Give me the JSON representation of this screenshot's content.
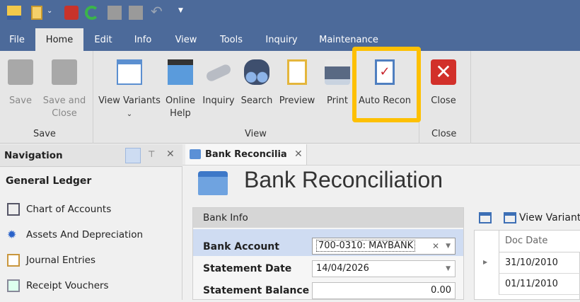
{
  "quick_access": [
    "app-icon",
    "clipboard-icon",
    "key-icon",
    "refresh-icon",
    "save-icon",
    "save-close-icon",
    "undo-icon",
    "customize-icon"
  ],
  "menu_tabs": [
    "File",
    "Home",
    "Edit",
    "Info",
    "View",
    "Tools",
    "Inquiry",
    "Maintenance"
  ],
  "active_tab": "Home",
  "ribbon": {
    "save_group": {
      "label": "Save",
      "buttons": [
        "Save",
        "Save and Close"
      ]
    },
    "view_group": {
      "label": "View",
      "buttons": {
        "view_variants": "View Variants",
        "online_help_1": "Online",
        "online_help_2": "Help",
        "inquiry": "Inquiry",
        "search": "Search",
        "preview": "Preview",
        "print": "Print",
        "auto_recon": "Auto Recon"
      }
    },
    "close_group": {
      "label": "Close",
      "button": "Close"
    },
    "highlight_color": "#fdc003"
  },
  "navigation": {
    "title": "Navigation",
    "section": "General Ledger",
    "items": [
      "Chart of Accounts",
      "Assets And Depreciation",
      "Journal Entries",
      "Receipt Vouchers"
    ]
  },
  "document_tab": "Bank Reconcilia",
  "page_title": "Bank Reconciliation",
  "bank_info": {
    "title": "Bank Info",
    "fields": [
      {
        "label": "Bank Account",
        "value": "700-0310: MAYBANK"
      },
      {
        "label": "Statement Date",
        "value": "14/04/2026"
      },
      {
        "label": "Statement Balance",
        "value": "0.00"
      }
    ]
  },
  "grid": {
    "toolbar_label": "View Variant",
    "column": "Doc Date",
    "rows": [
      "31/10/2010",
      "01/11/2010"
    ]
  }
}
